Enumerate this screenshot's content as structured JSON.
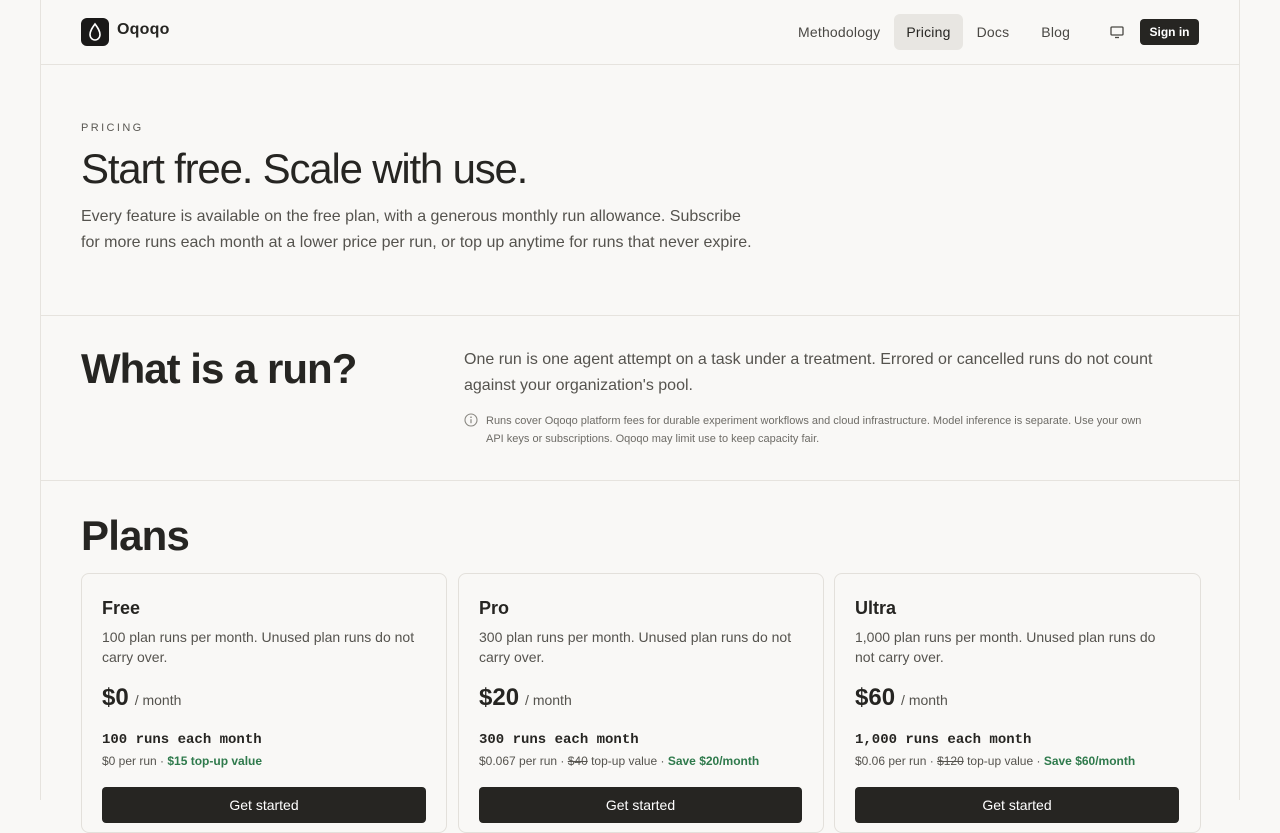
{
  "brand": {
    "name": "Oqoqo",
    "logo_icon": "droplet-logo-icon"
  },
  "nav": {
    "items": [
      {
        "label": "Methodology",
        "active": false
      },
      {
        "label": "Pricing",
        "active": true
      },
      {
        "label": "Docs",
        "active": false
      },
      {
        "label": "Blog",
        "active": false
      }
    ],
    "display_icon": "monitor-icon",
    "signin_label": "Sign in"
  },
  "hero": {
    "eyebrow": "PRICING",
    "title": "Start free. Scale with use.",
    "description": "Every feature is available on the free plan, with a generous monthly run allowance. Subscribe for more runs each month at a lower price per run, or top up anytime for runs that never expire."
  },
  "run": {
    "title": "What is a run?",
    "description": "One run is one agent attempt on a task under a treatment. Errored or cancelled runs do not count against your organization's pool.",
    "note_icon": "info-icon",
    "note": "Runs cover Oqoqo platform fees for durable experiment workflows and cloud infrastructure. Model inference is separate. Use your own API keys or subscriptions. Oqoqo may limit use to keep capacity fair."
  },
  "plans": {
    "title": "Plans",
    "cards": [
      {
        "name": "Free",
        "description": "100 plan runs per month. Unused plan runs do not carry over.",
        "price": "$0",
        "period": "/ month",
        "runs": "100 runs each month",
        "per_run": "$0 per run",
        "sep1": " · ",
        "strike": "",
        "topup_text": "",
        "sep2": "",
        "save": "$15 top-up value",
        "cta": "Get started"
      },
      {
        "name": "Pro",
        "description": "300 plan runs per month. Unused plan runs do not carry over.",
        "price": "$20",
        "period": "/ month",
        "runs": "300 runs each month",
        "per_run": "$0.067 per run",
        "sep1": " · ",
        "strike": "$40",
        "topup_text": " top-up value",
        "sep2": " · ",
        "save": "Save $20/month",
        "cta": "Get started"
      },
      {
        "name": "Ultra",
        "description": "1,000 plan runs per month. Unused plan runs do not carry over.",
        "price": "$60",
        "period": "/ month",
        "runs": "1,000 runs each month",
        "per_run": "$0.06 per run",
        "sep1": " · ",
        "strike": "$120",
        "topup_text": " top-up value",
        "sep2": " · ",
        "save": "Save $60/month",
        "cta": "Get started"
      }
    ]
  }
}
